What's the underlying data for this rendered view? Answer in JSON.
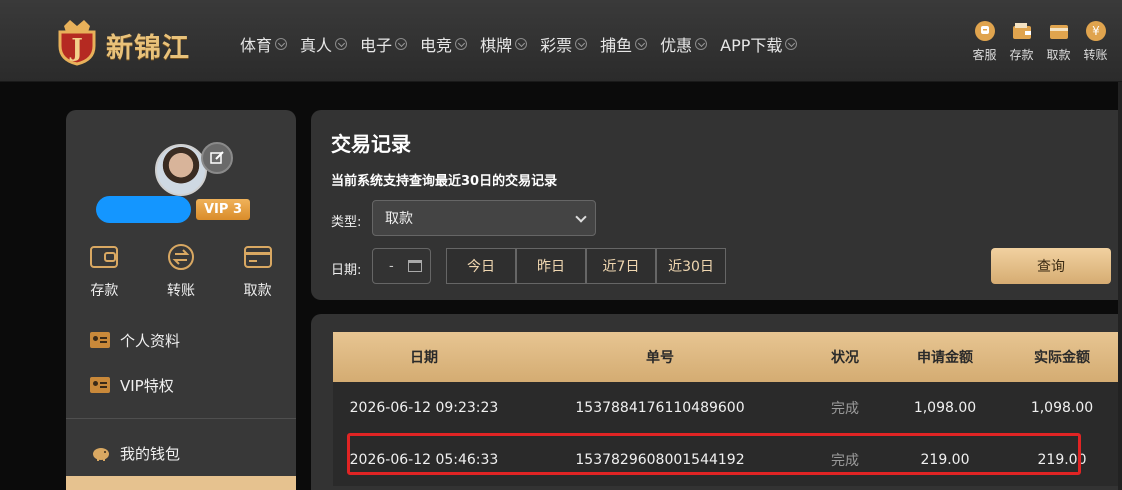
{
  "header": {
    "logo_text": "新锦江",
    "nav": [
      "体育",
      "真人",
      "电子",
      "电竞",
      "棋牌",
      "彩票",
      "捕鱼",
      "优惠",
      "APP下载"
    ],
    "quick": [
      {
        "label": "客服",
        "icon": "customer-service-icon"
      },
      {
        "label": "存款",
        "icon": "deposit-icon"
      },
      {
        "label": "取款",
        "icon": "withdraw-icon"
      },
      {
        "label": "转账",
        "icon": "transfer-icon"
      }
    ]
  },
  "sidebar": {
    "vip": "VIP 3",
    "actions": [
      {
        "label": "存款",
        "icon": "wallet-icon"
      },
      {
        "label": "转账",
        "icon": "transfer-icon"
      },
      {
        "label": "取款",
        "icon": "card-icon"
      }
    ],
    "menu": [
      "个人资料",
      "VIP特权",
      "我的钱包"
    ]
  },
  "panel": {
    "title": "交易记录",
    "subtitle": "当前系统支持查询最近30日的交易记录",
    "type_label": "类型:",
    "type_value": "取款",
    "date_label": "日期:",
    "date_value": "-",
    "quick_ranges": [
      "今日",
      "昨日",
      "近7日",
      "近30日"
    ],
    "search_label": "查询"
  },
  "table": {
    "headers": [
      "日期",
      "单号",
      "状况",
      "申请金额",
      "实际金额"
    ],
    "rows": [
      {
        "date": "2026-06-12 09:23:23",
        "order": "1537884176110489600",
        "status": "完成",
        "requested": "1,098.00",
        "actual": "1,098.00"
      },
      {
        "date": "2026-06-12 05:46:33",
        "order": "1537829608001544192",
        "status": "完成",
        "requested": "219.00",
        "actual": "219.00"
      }
    ]
  },
  "colors": {
    "accent_gold": "#d6ac72",
    "highlight_red": "#e02424",
    "name_blue": "#1496ff"
  }
}
